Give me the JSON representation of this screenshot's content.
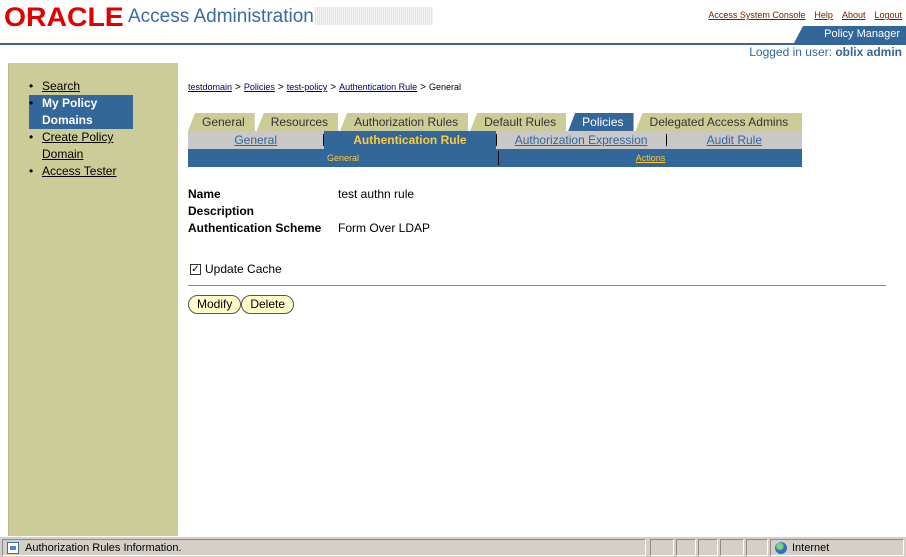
{
  "header": {
    "logo_text": "ORACLE",
    "app_title": "Access Administration",
    "top_links": [
      "Access System Console",
      "Help",
      "About",
      "Logout"
    ],
    "policy_manager_tab": "Policy Manager",
    "logged_in_prefix": "Logged in user:",
    "logged_in_user": "oblix admin"
  },
  "sidebar": {
    "items": [
      {
        "label": "Search",
        "active": false
      },
      {
        "label": "My Policy Domains",
        "active": true
      },
      {
        "label": "Create Policy Domain",
        "active": false
      },
      {
        "label": "Access Tester",
        "active": false
      }
    ]
  },
  "breadcrumb": [
    "testdomain",
    "Policies",
    "test-policy",
    "Authentication Rule",
    "General"
  ],
  "tabs": [
    {
      "label": "General",
      "active": false
    },
    {
      "label": "Resources",
      "active": false
    },
    {
      "label": "Authorization Rules",
      "active": false
    },
    {
      "label": "Default Rules",
      "active": false
    },
    {
      "label": "Policies",
      "active": true
    },
    {
      "label": "Delegated Access Admins",
      "active": false
    }
  ],
  "subtabs": [
    {
      "label": "General",
      "active": false
    },
    {
      "label": "Authentication Rule",
      "active": true
    },
    {
      "label": "Authorization Expression",
      "active": false
    },
    {
      "label": "Audit Rule",
      "active": false
    }
  ],
  "subsubtabs": [
    {
      "label": "General",
      "active": true
    },
    {
      "label": "Actions",
      "active": false
    }
  ],
  "fields": [
    {
      "label": "Name",
      "value": "test authn rule"
    },
    {
      "label": "Description",
      "value": ""
    },
    {
      "label": "Authentication Scheme",
      "value": "Form Over LDAP"
    }
  ],
  "update_cache": {
    "label": "Update Cache",
    "checked": true
  },
  "buttons": {
    "modify": "Modify",
    "delete": "Delete"
  },
  "statusbar": {
    "message": "Authorization Rules Information.",
    "zone": "Internet"
  }
}
